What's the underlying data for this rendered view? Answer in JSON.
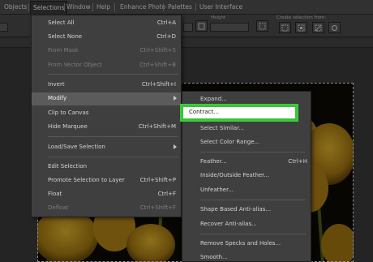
{
  "menubar": {
    "items": [
      {
        "label": "Objects"
      },
      {
        "label": "Selections"
      },
      {
        "label": "Window"
      },
      {
        "label": "Help"
      },
      {
        "label": "Enhance Photo"
      },
      {
        "label": "Palettes"
      },
      {
        "label": "User Interface"
      }
    ]
  },
  "toolbar": {
    "height_label": "Height",
    "create_selection_label": "Create selection from:"
  },
  "selections_menu": {
    "items": [
      {
        "label": "Select All",
        "shortcut": "Ctrl+A",
        "enabled": true
      },
      {
        "label": "Select None",
        "shortcut": "Ctrl+D",
        "enabled": true
      },
      {
        "label": "From Mask",
        "shortcut": "Ctrl+Shift+S",
        "enabled": false
      },
      {
        "label": "From Vector Object",
        "shortcut": "Ctrl+Shift+B",
        "enabled": false
      },
      {
        "label": "Invert",
        "shortcut": "Ctrl+Shift+I",
        "enabled": true
      },
      {
        "label": "Modify",
        "shortcut": "",
        "enabled": true,
        "submenu": true
      },
      {
        "label": "Clip to Canvas",
        "shortcut": "",
        "enabled": true
      },
      {
        "label": "Hide Marquee",
        "shortcut": "Ctrl+Shift+M",
        "enabled": true
      },
      {
        "label": "Load/Save Selection",
        "shortcut": "",
        "enabled": true,
        "submenu": true
      },
      {
        "label": "Edit Selection",
        "shortcut": "",
        "enabled": true
      },
      {
        "label": "Promote Selection to Layer",
        "shortcut": "Ctrl+Shift+P",
        "enabled": true
      },
      {
        "label": "Float",
        "shortcut": "Ctrl+F",
        "enabled": true
      },
      {
        "label": "Defloat",
        "shortcut": "Ctrl+Shift+F",
        "enabled": false
      }
    ]
  },
  "modify_menu": {
    "items": [
      {
        "label": "Expand...",
        "shortcut": ""
      },
      {
        "label": "Contract...",
        "shortcut": ""
      },
      {
        "label": "Select Similar...",
        "shortcut": ""
      },
      {
        "label": "Select Color Range...",
        "shortcut": ""
      },
      {
        "label": "Feather...",
        "shortcut": "Ctrl+H"
      },
      {
        "label": "Inside/Outside Feather...",
        "shortcut": ""
      },
      {
        "label": "Unfeather...",
        "shortcut": ""
      },
      {
        "label": "Shape Based Anti-alias...",
        "shortcut": ""
      },
      {
        "label": "Recover Anti-alias...",
        "shortcut": ""
      },
      {
        "label": "Remove Specks and Holes...",
        "shortcut": ""
      },
      {
        "label": "Smooth...",
        "shortcut": ""
      }
    ]
  },
  "colors": {
    "highlight_border": "#35d135",
    "menu_bg": "#3f3f3f"
  }
}
